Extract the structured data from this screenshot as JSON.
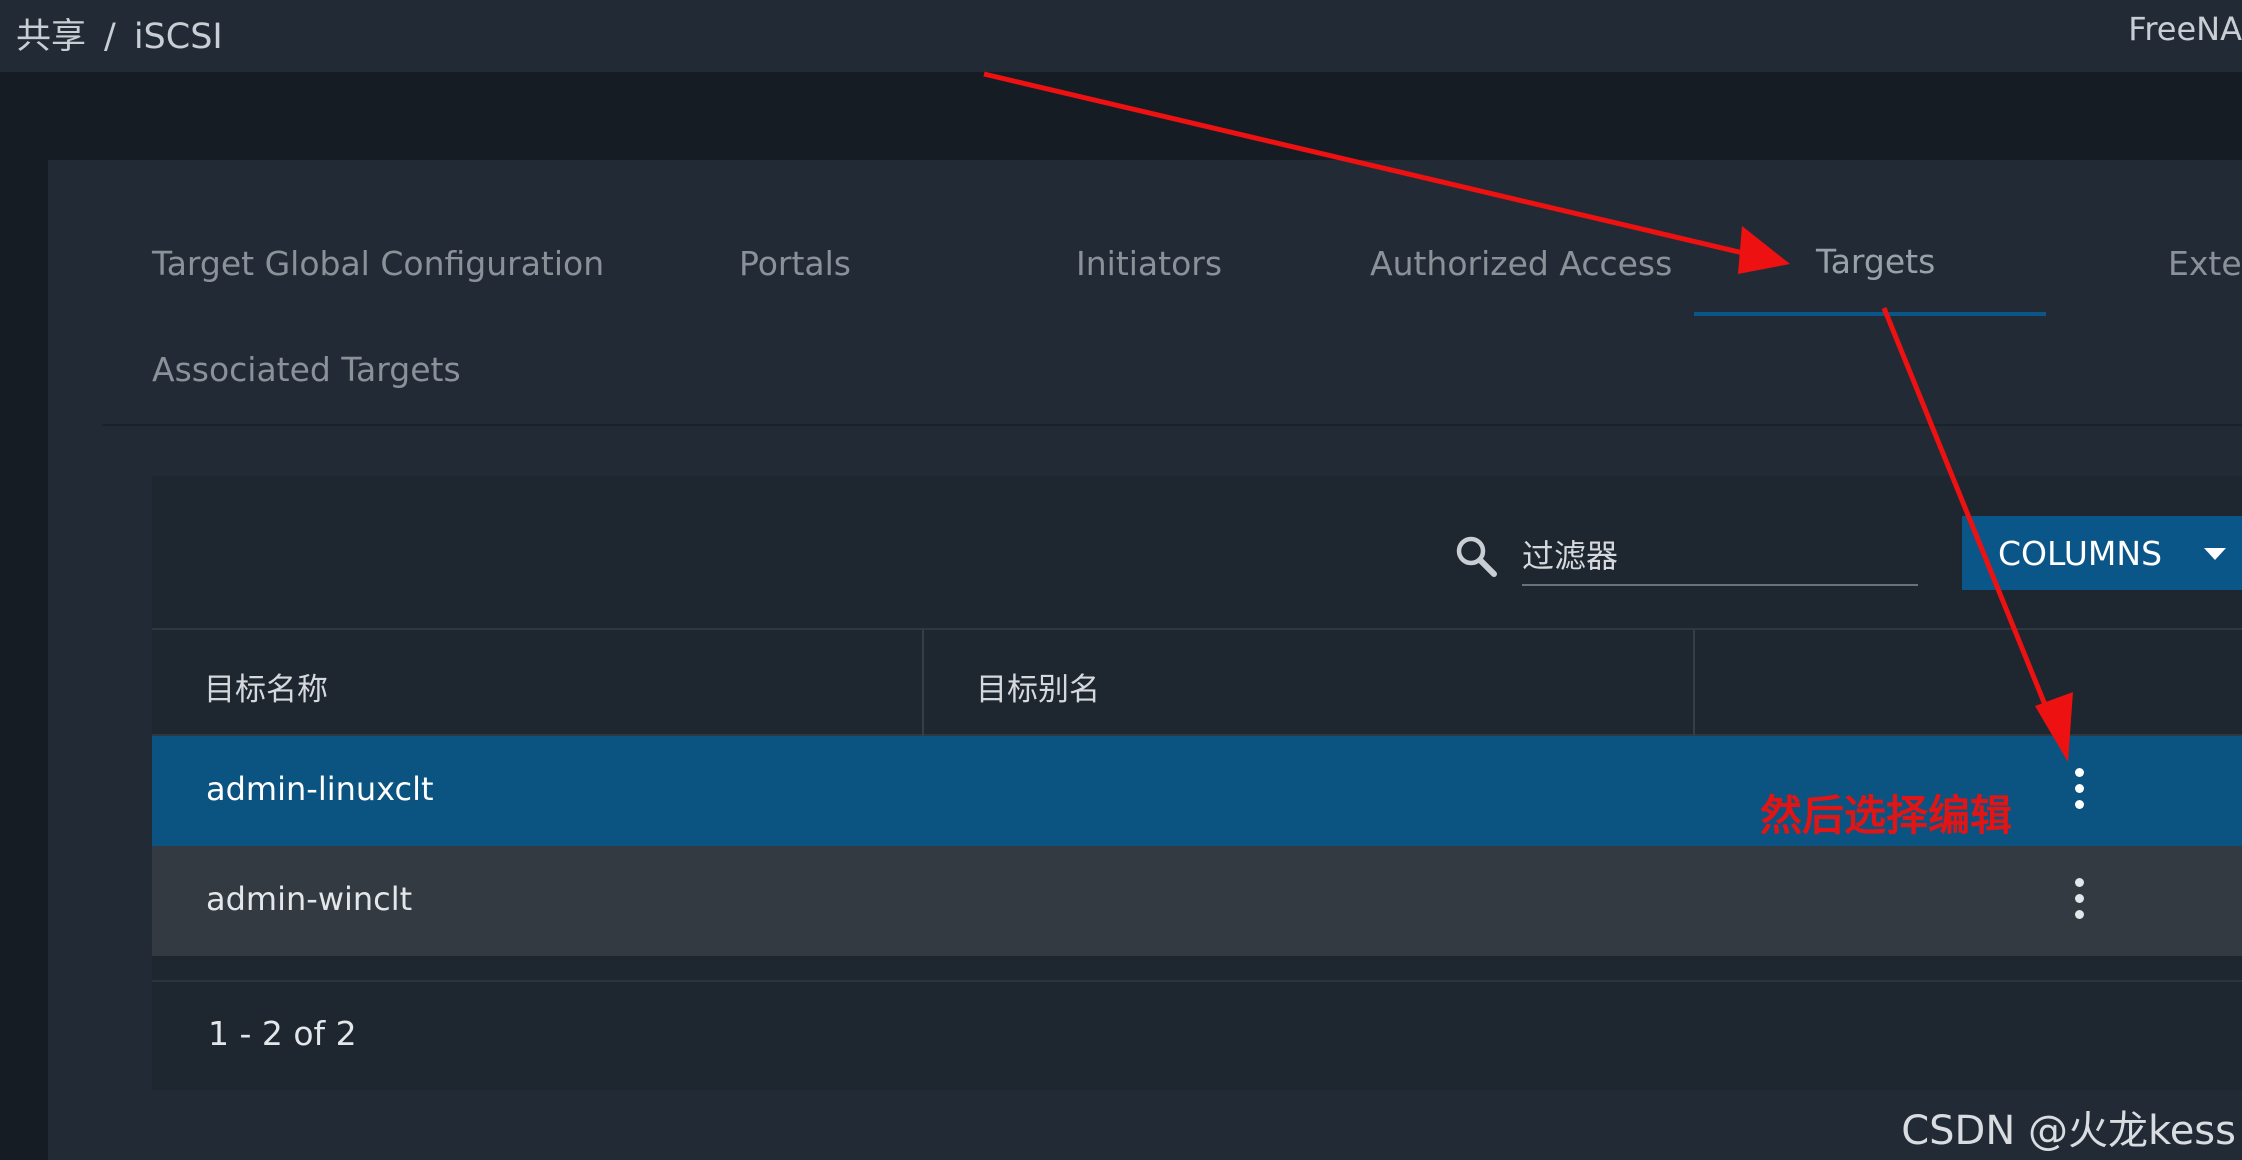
{
  "header": {
    "breadcrumb": [
      "共享",
      "/",
      "iSCSI"
    ],
    "brand": "FreeNA"
  },
  "tabs": [
    {
      "label": "Target Global Configuration",
      "active": false
    },
    {
      "label": "Portals",
      "active": false
    },
    {
      "label": "Initiators",
      "active": false
    },
    {
      "label": "Authorized Access",
      "active": false
    },
    {
      "label": "Targets",
      "active": true
    },
    {
      "label": "Exten",
      "active": false
    },
    {
      "label": "Associated Targets",
      "active": false
    }
  ],
  "toolbar": {
    "search_icon": "search-icon",
    "filter_placeholder": "过滤器",
    "columns_label": "COLUMNS"
  },
  "table": {
    "columns": [
      "目标名称",
      "目标别名",
      ""
    ],
    "rows": [
      {
        "name": "admin-linuxclt",
        "alias": "",
        "selected": true
      },
      {
        "name": "admin-winclt",
        "alias": "",
        "selected": false
      }
    ],
    "pagination": "1 - 2 of 2"
  },
  "annotation": {
    "text": "然后选择编辑",
    "color": "#e01515"
  },
  "watermark": "CSDN @火龙kess",
  "colors": {
    "accent": "#0b5688",
    "selected_row": "#0b5381",
    "arrow": "#ee1111"
  }
}
